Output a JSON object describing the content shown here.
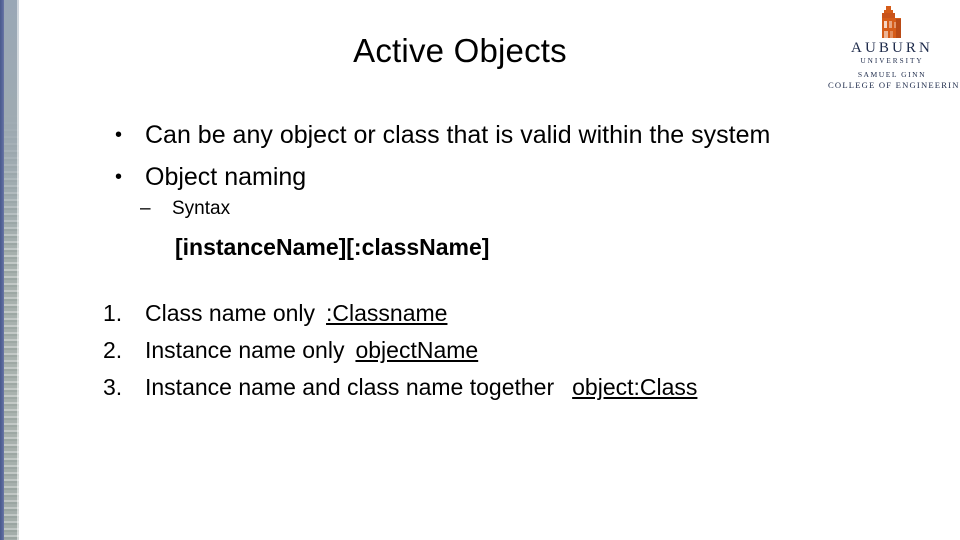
{
  "slide": {
    "title": "Active Objects",
    "logo": {
      "mark_icon": "auburn-tower-icon",
      "wordmark": "AUBURN",
      "sub_wordmark": "UNIVERSITY",
      "college_line1": "SAMUEL GINN",
      "college_line2": "COLLEGE OF ENGINEERING",
      "mark_color": "#D55C19",
      "text_color": "#1D2A4A"
    },
    "bullets": [
      {
        "marker": "•",
        "text": "Can be any object or class that is valid within the system"
      },
      {
        "marker": "•",
        "text": "Object naming"
      }
    ],
    "sub_bullet": {
      "marker": "–",
      "text": "Syntax"
    },
    "syntax": "[instanceName][:className]",
    "numbered_list": [
      {
        "number": "1.",
        "label": "Class name only",
        "code": ":Classname"
      },
      {
        "number": "2.",
        "label": "Instance name only",
        "code": "objectName"
      },
      {
        "number": "3.",
        "label": "Instance name and class name together",
        "code": "object:Class"
      }
    ],
    "decoration": {
      "strip_border_color": "#4A5A8C",
      "strip_fill_color": "#A3ADAA"
    }
  }
}
